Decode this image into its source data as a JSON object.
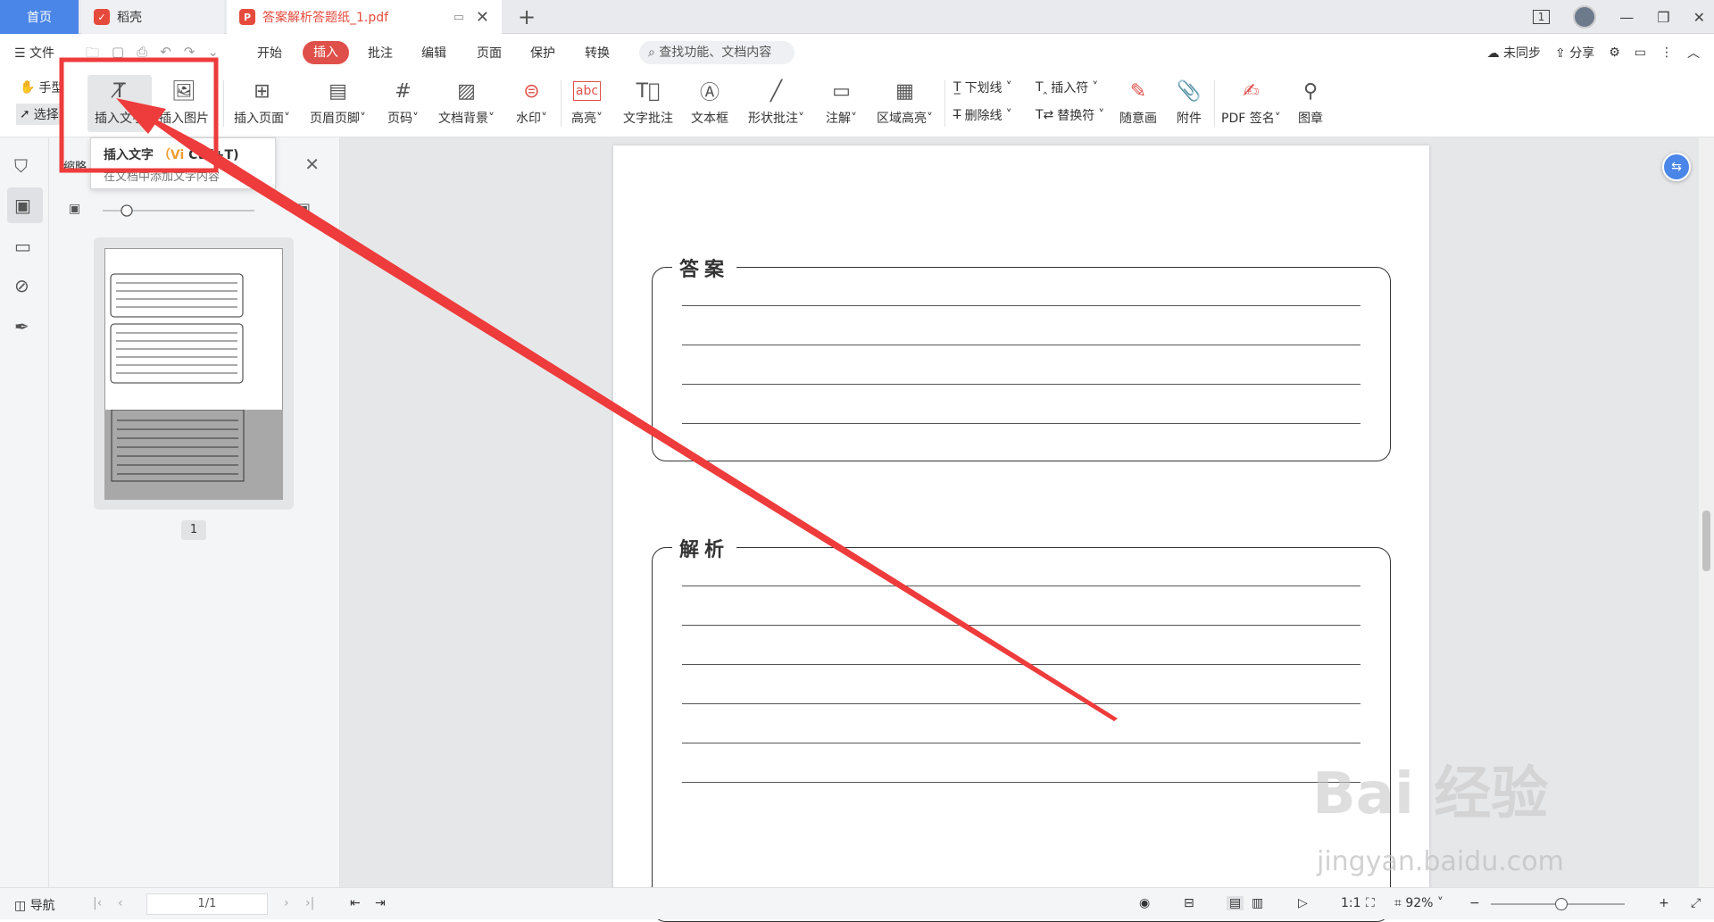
{
  "tabs": {
    "home": "首页",
    "daoke": "稻壳",
    "pdf": "答案解析答题纸_1.pdf",
    "new": "+"
  },
  "window": {
    "page_indicator": "1"
  },
  "menu": {
    "file": "文件",
    "items": [
      "开始",
      "插入",
      "批注",
      "编辑",
      "页面",
      "保护",
      "转换"
    ],
    "search_placeholder": "查找功能、文档内容",
    "sync": "未同步",
    "share": "分享"
  },
  "ribbon": {
    "hand": "手型",
    "select": "选择",
    "insert_text": "插入文字",
    "insert_image": "插入图片",
    "insert_page": "插入页面",
    "header_footer": "页眉页脚",
    "page_number": "页码",
    "doc_background": "文档背景",
    "watermark": "水印",
    "highlight": "高亮",
    "text_comment": "文字批注",
    "textbox": "文本框",
    "shape_comment": "形状批注",
    "annotation": "注解",
    "area_highlight": "区域高亮",
    "underline": "下划线",
    "strikethrough": "删除线",
    "insert_mark": "插入符",
    "replace_mark": "替换符",
    "freehand": "随意画",
    "attachment": "附件",
    "pdf_sign": "PDF 签名",
    "stamp": "图章",
    "highlight_icon_text": "abc"
  },
  "tooltip": {
    "title": "插入文字",
    "shortcut_open": "（Vi",
    "shortcut_close": "Ctrl+T)",
    "desc": "在文档中添加文字内容"
  },
  "thumbnail_panel": {
    "title": "缩略",
    "page_number": "1"
  },
  "document": {
    "section1_title": "答案",
    "section2_title": "解析"
  },
  "statusbar": {
    "nav": "导航",
    "page_input": "1/1",
    "zoom": "92%"
  },
  "watermark": {
    "brand": "Bai 经验",
    "url": "jingyan.baidu.com"
  },
  "colors": {
    "accent_red": "#e0504a",
    "home_tab_blue": "#4a86e8",
    "annotation_red": "#ee3b3b"
  }
}
